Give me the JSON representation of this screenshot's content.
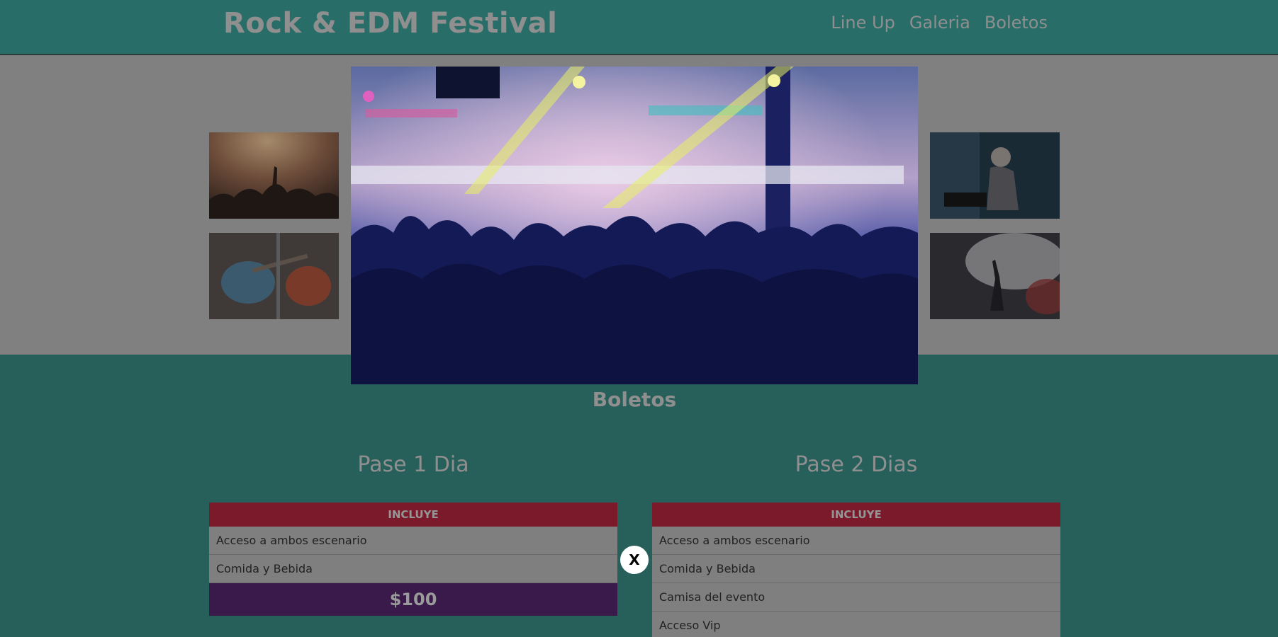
{
  "header": {
    "title": "Rock & EDM Festival",
    "nav": [
      "Line Up",
      "Galeria",
      "Boletos"
    ]
  },
  "modal": {
    "close_label": "X"
  },
  "tickets": {
    "section_title": "Boletos",
    "passes": [
      {
        "title": "Pase 1 Dia",
        "includes_label": "INCLUYE",
        "items": [
          "Acceso a ambos escenario",
          "Comida y Bebida"
        ],
        "price": "$100"
      },
      {
        "title": "Pase 2 Dias",
        "includes_label": "INCLUYE",
        "items": [
          "Acceso a ambos escenario",
          "Comida y Bebida",
          "Camisa del evento",
          "Acceso Vip"
        ]
      }
    ]
  },
  "colors": {
    "header_bg": "#296d68",
    "tickets_bg": "#275f5b",
    "includes_bg": "#7a1a2b",
    "price_bg": "#3a1a4a"
  }
}
